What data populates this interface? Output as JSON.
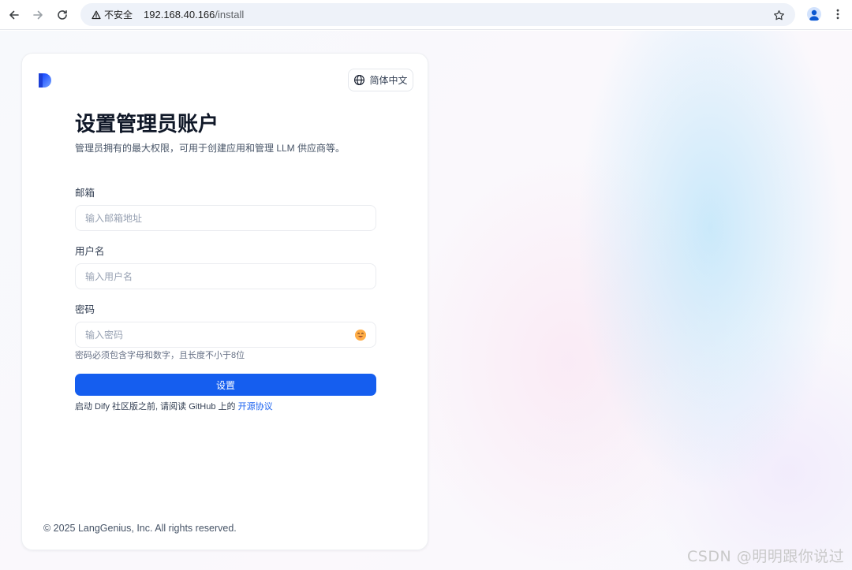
{
  "browser": {
    "security_label": "不安全",
    "url_host": "192.168.40.166",
    "url_path": "/install"
  },
  "card": {
    "language_label": "简体中文",
    "title": "设置管理员账户",
    "subtitle": "管理员拥有的最大权限，可用于创建应用和管理 LLM 供应商等。",
    "fields": {
      "email": {
        "label": "邮箱",
        "placeholder": "输入邮箱地址"
      },
      "username": {
        "label": "用户名",
        "placeholder": "输入用户名"
      },
      "password": {
        "label": "密码",
        "placeholder": "输入密码",
        "hint": "密码必须包含字母和数字，且长度不小于8位"
      }
    },
    "submit_label": "设置",
    "license_prefix": "启动 Dify 社区版之前, 请阅读 GitHub 上的 ",
    "license_link": "开源协议",
    "copyright": "© 2025 LangGenius, Inc. All rights reserved."
  },
  "watermark": "CSDN @明明跟你说过",
  "colors": {
    "primary": "#155eef",
    "background": "#f7f9fc"
  },
  "icons": {
    "back": "arrow-left-icon",
    "forward": "arrow-right-icon",
    "reload": "reload-icon",
    "warning": "warning-triangle-icon",
    "star": "star-icon",
    "profile": "profile-icon",
    "menu": "more-vertical-icon",
    "globe": "globe-icon",
    "password_toggle": "emoji-face-icon"
  }
}
